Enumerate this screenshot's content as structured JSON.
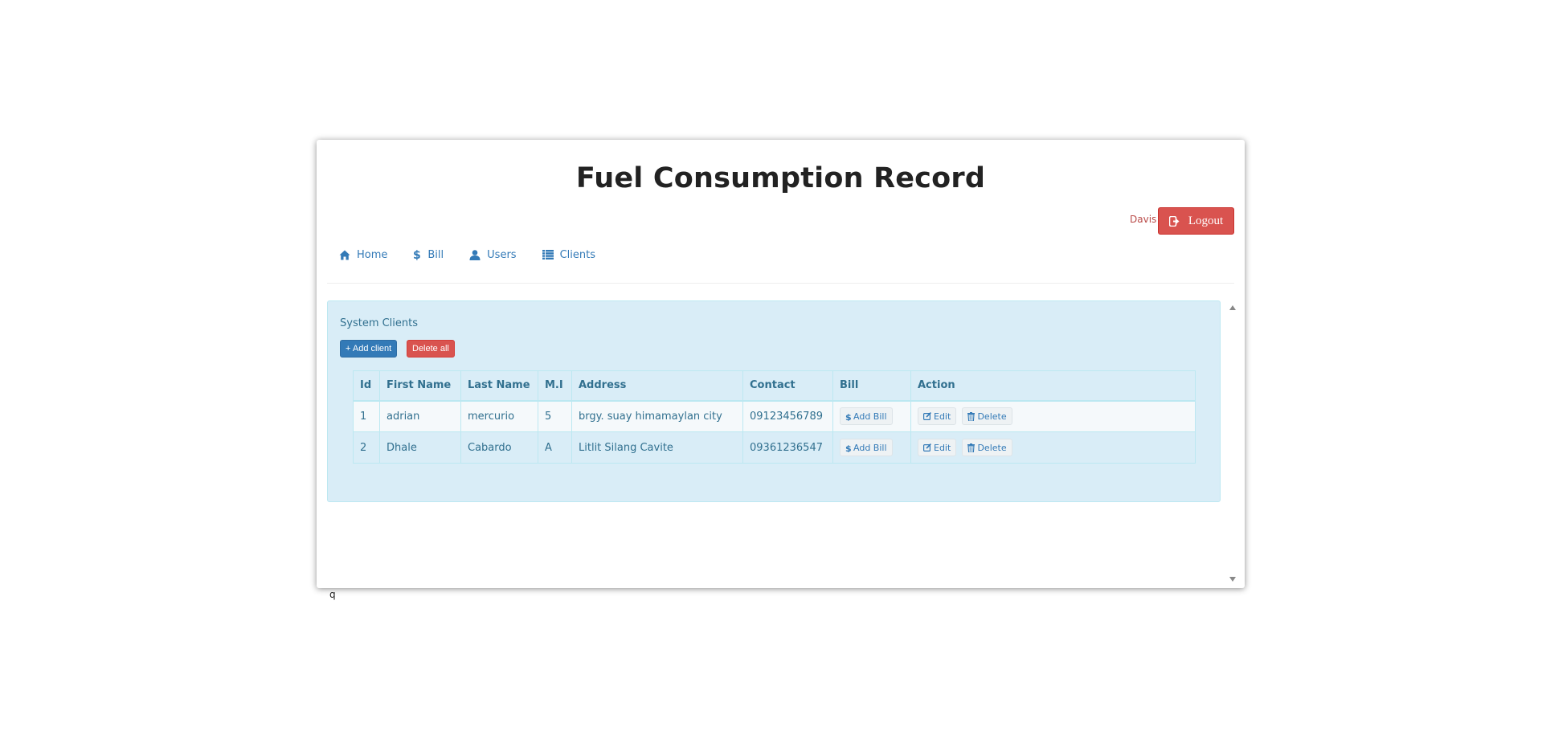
{
  "header": {
    "title": "Fuel Consumption Record",
    "user_name": "Davis",
    "logout_label": "Logout"
  },
  "nav": {
    "items": [
      {
        "label": "Home",
        "icon": "home-icon"
      },
      {
        "label": "Bill",
        "icon": "dollar-icon"
      },
      {
        "label": "Users",
        "icon": "user-icon"
      },
      {
        "label": "Clients",
        "icon": "list-icon"
      }
    ]
  },
  "panel": {
    "title": "System Clients",
    "add_client_label": "+ Add client",
    "delete_all_label": "Delete all"
  },
  "table": {
    "columns": [
      "Id",
      "First Name",
      "Last Name",
      "M.I",
      "Address",
      "Contact",
      "Bill",
      "Action"
    ],
    "rows": [
      {
        "id": "1",
        "first_name": "adrian",
        "last_name": "mercurio",
        "mi": "5",
        "address": "brgy. suay himamaylan city",
        "contact": "09123456789"
      },
      {
        "id": "2",
        "first_name": "Dhale",
        "last_name": "Cabardo",
        "mi": "A",
        "address": "Litlit Silang Cavite",
        "contact": "09361236547"
      }
    ],
    "add_bill_label": "Add Bill",
    "edit_label": "Edit",
    "delete_label": "Delete"
  },
  "stray_text": "q",
  "colors": {
    "primary": "#337ab7",
    "danger": "#d9534f",
    "panel_bg": "#d9edf7",
    "panel_text": "#31708f"
  }
}
